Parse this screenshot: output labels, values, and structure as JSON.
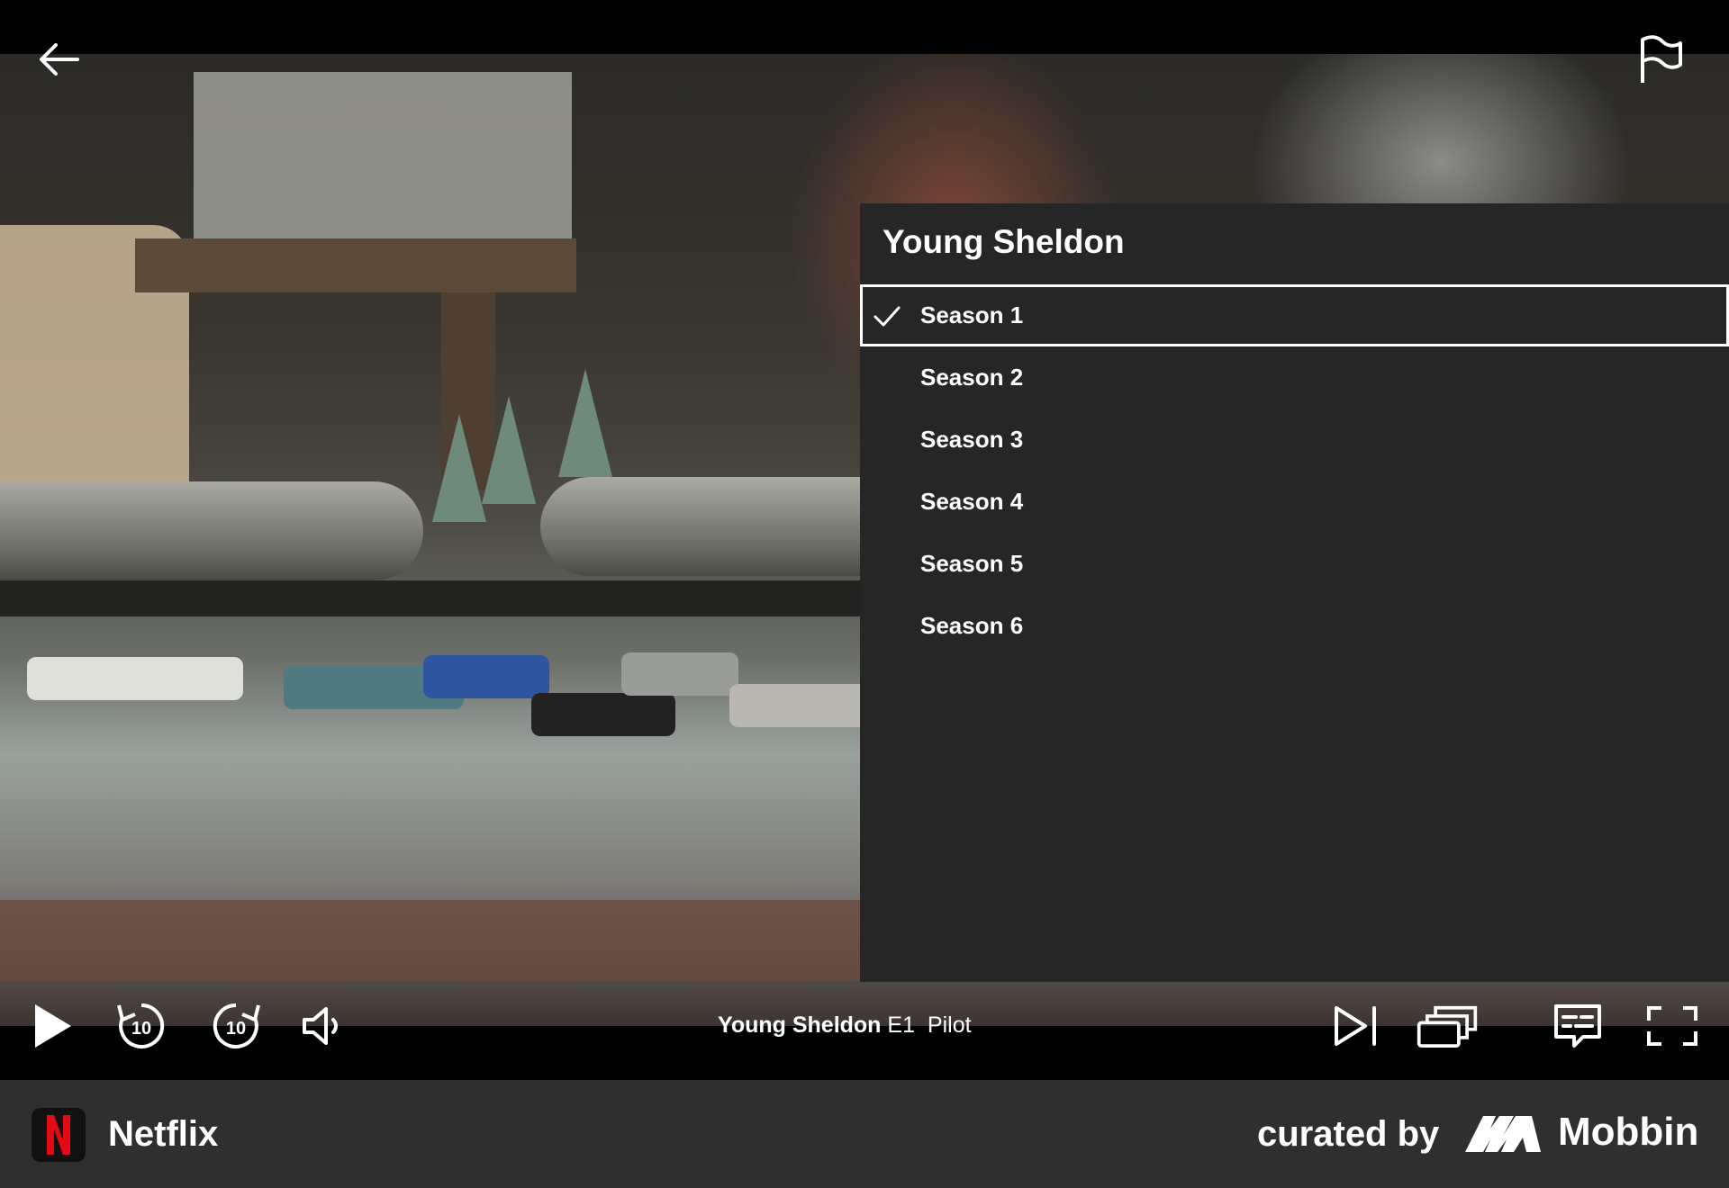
{
  "player": {
    "back_icon": "arrow-left-icon",
    "report_icon": "flag-icon"
  },
  "season_panel": {
    "title": "Young Sheldon",
    "seasons": [
      {
        "label": "Season 1",
        "selected": true
      },
      {
        "label": "Season 2",
        "selected": false
      },
      {
        "label": "Season 3",
        "selected": false
      },
      {
        "label": "Season 4",
        "selected": false
      },
      {
        "label": "Season 5",
        "selected": false
      },
      {
        "label": "Season 6",
        "selected": false
      }
    ]
  },
  "controls": {
    "show_title": "Young Sheldon",
    "episode_number": "E1",
    "episode_title": "Pilot",
    "skip_back_seconds": "10",
    "skip_forward_seconds": "10",
    "icons": [
      "play-icon",
      "rewind-10-icon",
      "forward-10-icon",
      "volume-icon",
      "next-episode-icon",
      "episodes-icon",
      "subtitles-icon",
      "fullscreen-icon"
    ]
  },
  "footer": {
    "app_name": "Netflix",
    "curated_by": "curated by",
    "brand": "Mobbin"
  },
  "colors": {
    "netflix_red": "#E50914",
    "panel_bg": "#262626",
    "footer_bg": "#2F2F2F"
  }
}
